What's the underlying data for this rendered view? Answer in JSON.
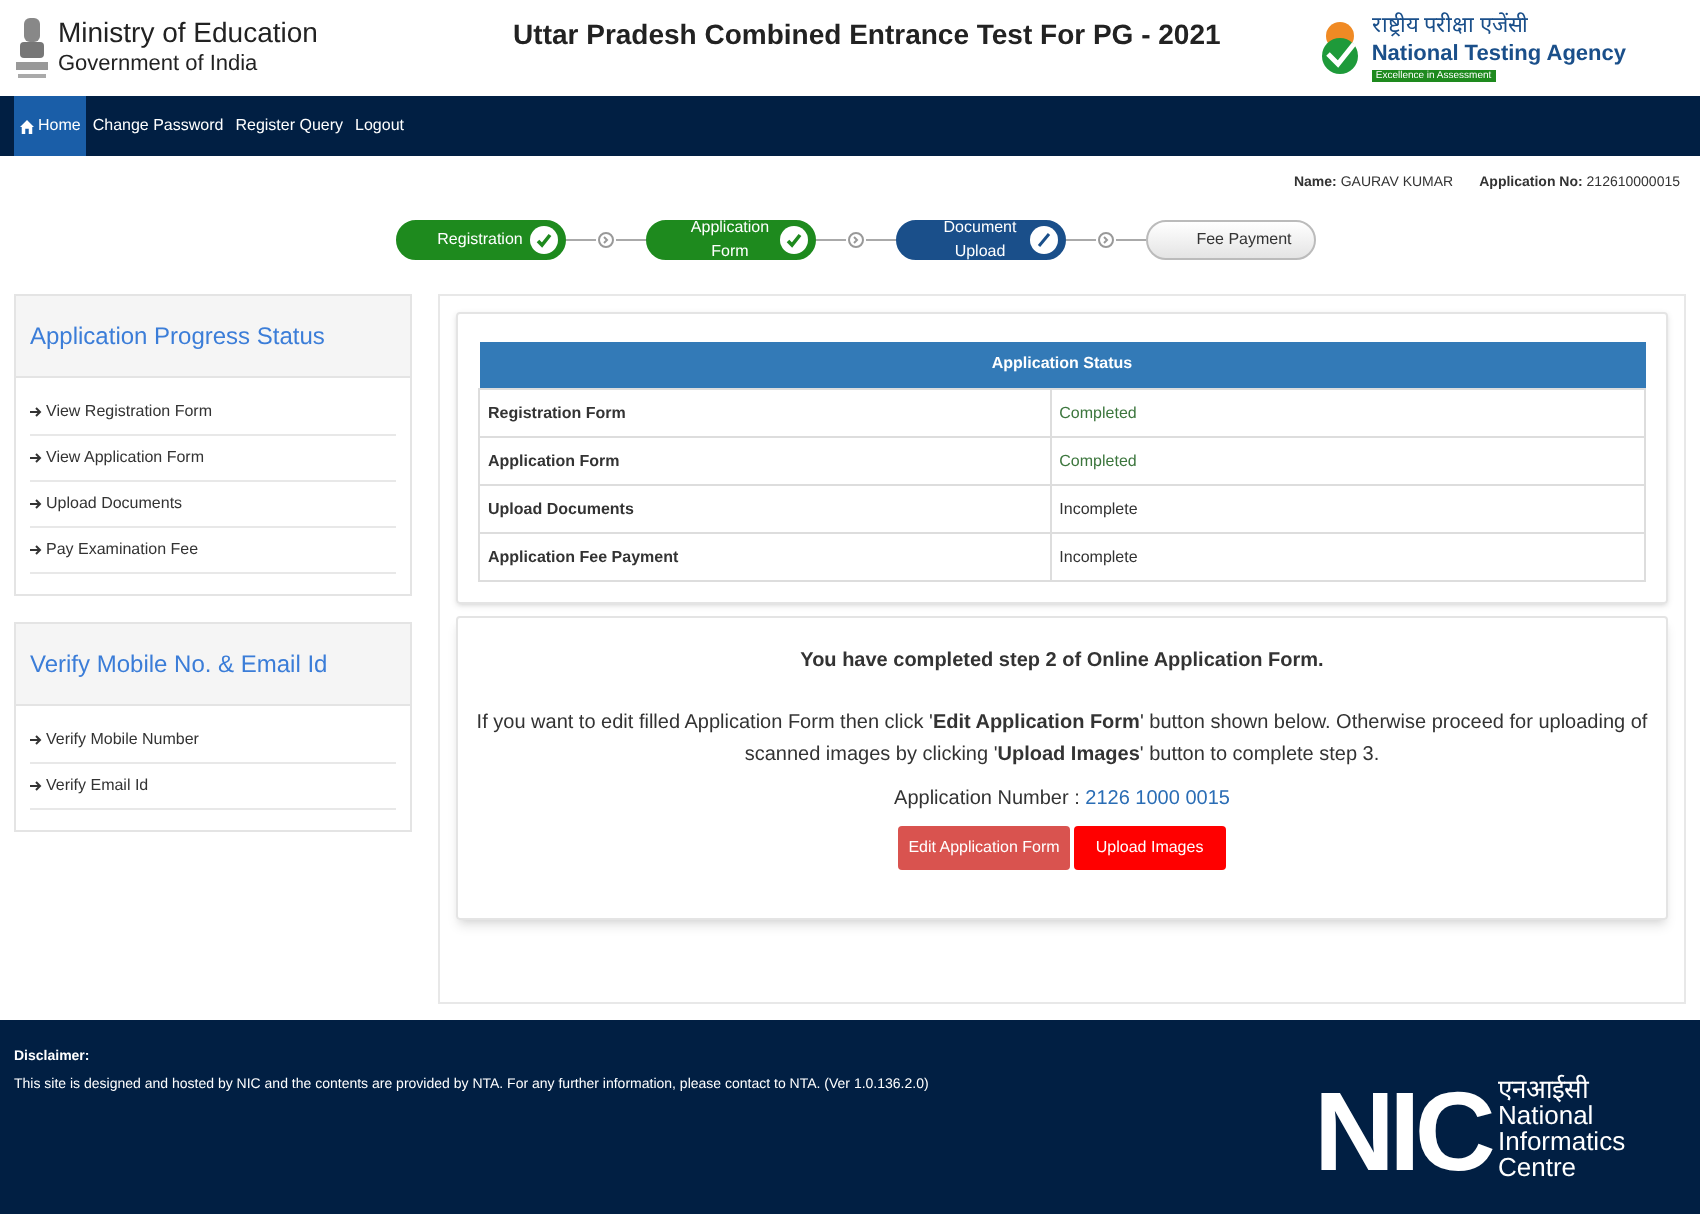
{
  "header": {
    "ministry": "Ministry of Education",
    "government": "Government of India",
    "title": "Uttar Pradesh Combined Entrance Test For PG - 2021",
    "agency_hindi": "राष्ट्रीय परीक्षा एजेंसी",
    "agency": "National Testing Agency",
    "agency_tagline": "Excellence in Assessment"
  },
  "nav": [
    {
      "label": "Home",
      "selected": true
    },
    {
      "label": "Change Password",
      "selected": false
    },
    {
      "label": "Register Query",
      "selected": false
    },
    {
      "label": "Logout",
      "selected": false
    }
  ],
  "candidate": {
    "name_label": "Name:",
    "name": "GAURAV KUMAR",
    "appno_label": "Application No:",
    "appno": "212610000015"
  },
  "steps": [
    {
      "label": "Registration",
      "kind": "done"
    },
    {
      "label": "Application Form",
      "kind": "done"
    },
    {
      "label": "Document Upload",
      "kind": "current"
    },
    {
      "label": "Fee Payment",
      "kind": "pending"
    }
  ],
  "sidebar": [
    {
      "title": "Application Progress Status",
      "items": [
        "View Registration Form",
        "View Application Form",
        "Upload Documents",
        "Pay Examination Fee"
      ]
    },
    {
      "title": "Verify Mobile No. & Email Id",
      "items": [
        "Verify Mobile Number",
        "Verify Email Id"
      ]
    }
  ],
  "status_table": {
    "title": "Application Status",
    "rows": [
      {
        "item": "Registration Form",
        "status": "Completed",
        "completed": true
      },
      {
        "item": "Application Form",
        "status": "Completed",
        "completed": true
      },
      {
        "item": "Upload Documents",
        "status": "Incomplete",
        "completed": false
      },
      {
        "item": "Application Fee Payment",
        "status": "Incomplete",
        "completed": false
      }
    ]
  },
  "message": {
    "heading": "You have completed step 2 of Online Application Form.",
    "body": "If you want to edit filled Application Form then click '**Edit Application Form**' button shown below. Otherwise proceed for uploading of scanned images by clicking '**Upload Images**' button to complete step 3.",
    "appnum_label": "Application Number :",
    "appnum": "2126 1000 0015"
  },
  "buttons": [
    "Edit Application Form",
    "Upload Images"
  ],
  "footer": {
    "disclaimer_title": "Disclaimer:",
    "disclaimer": "This site is designed and hosted by NIC and the contents are provided by NTA. For any further information, please contact to NTA. (Ver 1.0.136.2.0)",
    "nic_mark": "NIC",
    "nic_hindi": "एनआईसी",
    "nic_name": "National Informatics Centre"
  }
}
